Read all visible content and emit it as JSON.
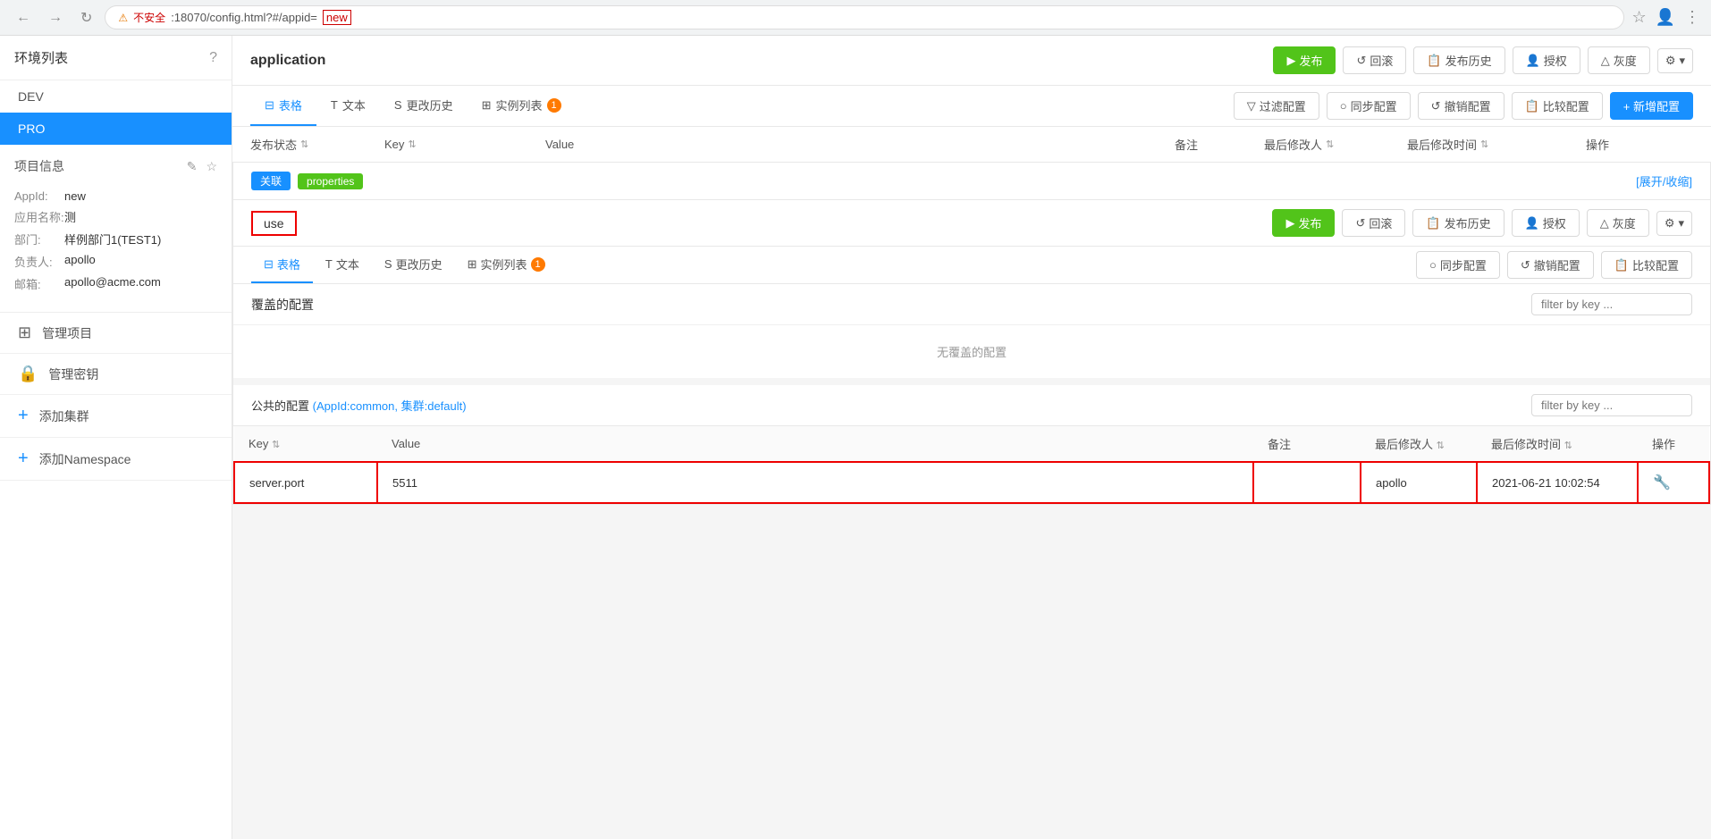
{
  "browser": {
    "url_prefix": "不安全",
    "url_middle": ":18070/config.html?#/appid=",
    "url_highlight": "new",
    "back_title": "后退",
    "forward_title": "前进",
    "reload_title": "重新加载"
  },
  "sidebar": {
    "env_list_label": "环境列表",
    "help_icon": "?",
    "envs": [
      {
        "name": "DEV",
        "active": false
      },
      {
        "name": "PRO",
        "active": true
      }
    ],
    "project_info_label": "项目信息",
    "edit_icon": "✎",
    "star_icon": "☆",
    "fields": [
      {
        "label": "AppId:",
        "value": "new"
      },
      {
        "label": "应用名称:",
        "value": "测"
      },
      {
        "label": "部门:",
        "value": "样例部门1(TEST1)"
      },
      {
        "label": "负责人:",
        "value": "apollo"
      },
      {
        "label": "邮箱:",
        "value": "apollo@acme.com"
      }
    ],
    "menu_items": [
      {
        "icon": "⊞",
        "label": "管理项目",
        "name": "manage-project"
      },
      {
        "icon": "🔒",
        "label": "管理密钥",
        "name": "manage-key"
      },
      {
        "icon": "+",
        "label": "添加集群",
        "name": "add-cluster"
      },
      {
        "icon": "+",
        "label": "添加Namespace",
        "name": "add-namespace"
      }
    ]
  },
  "main": {
    "title": "application",
    "header_buttons": [
      {
        "label": "发布",
        "type": "primary",
        "icon": "▶"
      },
      {
        "label": "回滚",
        "type": "default",
        "icon": "↺"
      },
      {
        "label": "发布历史",
        "type": "default",
        "icon": "📋"
      },
      {
        "label": "授权",
        "type": "default",
        "icon": "👤"
      },
      {
        "label": "灰度",
        "type": "default",
        "icon": "△"
      },
      {
        "label": "⚙",
        "type": "gear",
        "icon": ""
      }
    ],
    "tabs": [
      {
        "label": "表格",
        "icon": "⊟",
        "active": true,
        "badge": null
      },
      {
        "label": "文本",
        "icon": "T",
        "active": false,
        "badge": null
      },
      {
        "label": "更改历史",
        "icon": "S",
        "active": false,
        "badge": null
      },
      {
        "label": "实例列表",
        "icon": "⊞",
        "active": false,
        "badge": "1"
      }
    ],
    "tab_actions": [
      {
        "label": "过滤配置",
        "icon": "▽"
      },
      {
        "label": "同步配置",
        "icon": "○"
      },
      {
        "label": "撤销配置",
        "icon": "↺"
      },
      {
        "label": "比较配置",
        "icon": "📋"
      },
      {
        "label": "+ 新增配置",
        "type": "blue"
      }
    ],
    "table_headers": [
      "发布状态",
      "Key",
      "Value",
      "备注",
      "最后修改人",
      "最后修改时间",
      "操作"
    ],
    "namespace": {
      "tag_guanlian": "关联",
      "tag_properties": "properties",
      "expand_collapse_label": "[展开/收缩]",
      "name": "use",
      "inner_buttons": [
        {
          "label": "发布",
          "type": "primary",
          "icon": "▶"
        },
        {
          "label": "回滚",
          "type": "default",
          "icon": "↺"
        },
        {
          "label": "发布历史",
          "type": "default",
          "icon": "📋"
        },
        {
          "label": "授权",
          "type": "default",
          "icon": "👤"
        },
        {
          "label": "灰度",
          "type": "default",
          "icon": "△"
        },
        {
          "label": "⚙",
          "type": "gear",
          "icon": ""
        }
      ],
      "inner_tab_actions": [
        {
          "label": "同步配置",
          "icon": "○"
        },
        {
          "label": "撤销配置",
          "icon": "↺"
        },
        {
          "label": "比较配置",
          "icon": "📋"
        }
      ],
      "inner_tabs": [
        {
          "label": "表格",
          "icon": "⊟",
          "active": true
        },
        {
          "label": "文本",
          "icon": "T",
          "active": false
        },
        {
          "label": "更改历史",
          "icon": "S",
          "active": false
        },
        {
          "label": "实例列表",
          "icon": "⊞",
          "active": false,
          "badge": "1"
        }
      ],
      "coverage_label": "覆盖的配置",
      "filter_placeholder": "filter by key ...",
      "no_coverage_text": "无覆盖的配置",
      "public_config": {
        "title_prefix": "公共的配置 ",
        "appid_link": "(AppId:common, 集群:default)",
        "filter_placeholder": "filter by key ...",
        "table_headers": [
          "Key",
          "Value",
          "备注",
          "最后修改人",
          "最后修改时间",
          "操作"
        ],
        "rows": [
          {
            "key": "server.port",
            "value": "5511",
            "note": "",
            "modifier": "apollo",
            "modify_time": "2021-06-21 10:02:54",
            "highlighted": true
          }
        ]
      }
    }
  }
}
